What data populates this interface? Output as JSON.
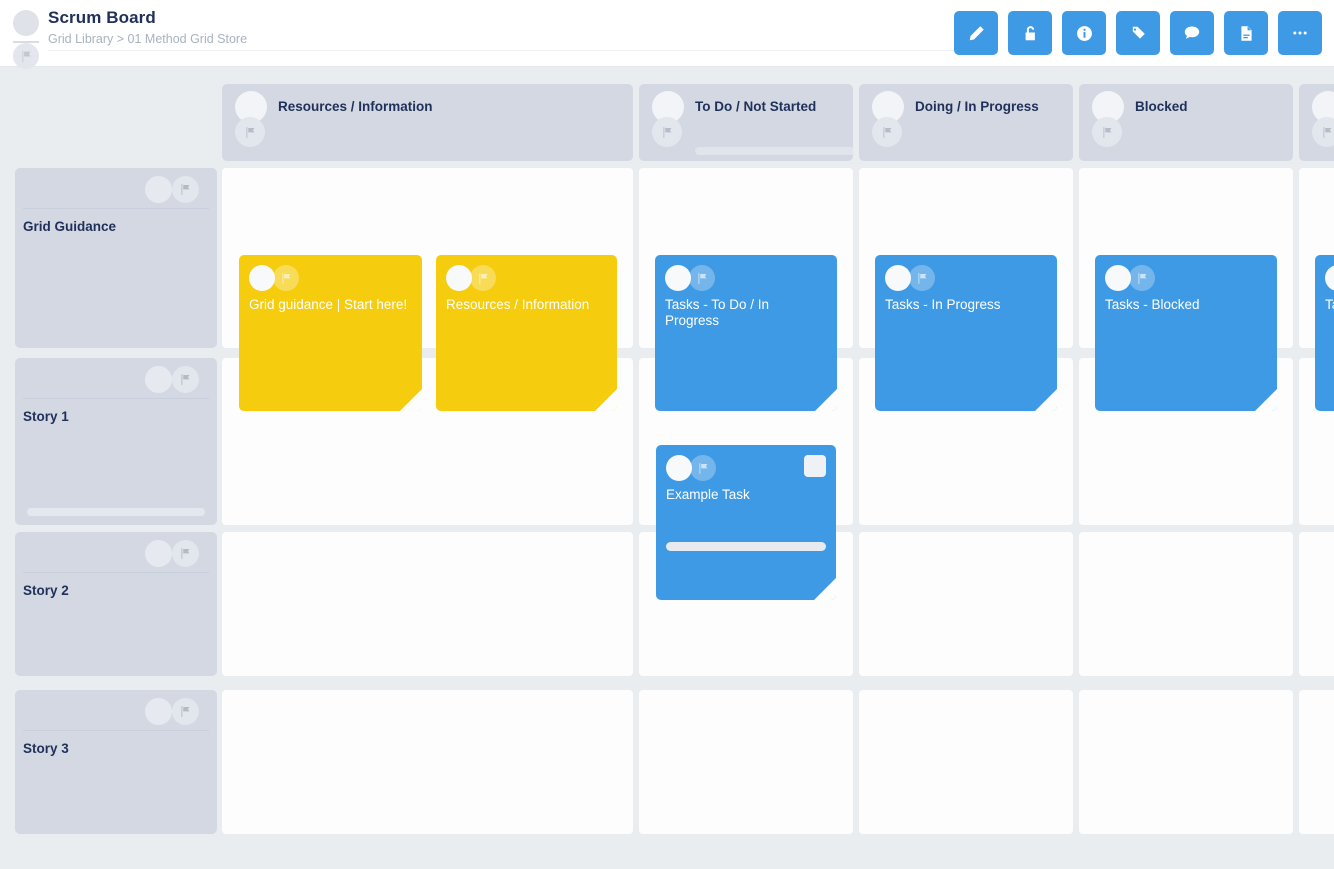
{
  "header": {
    "title": "Scrum Board",
    "breadcrumb": "Grid Library > 01 Method Grid Store",
    "toolbar": [
      {
        "name": "edit-button",
        "icon": "pencil-icon"
      },
      {
        "name": "unlock-button",
        "icon": "unlock-icon"
      },
      {
        "name": "info-button",
        "icon": "info-icon"
      },
      {
        "name": "tag-button",
        "icon": "tag-icon"
      },
      {
        "name": "comment-button",
        "icon": "comment-icon"
      },
      {
        "name": "export-pdf-button",
        "icon": "document-icon"
      },
      {
        "name": "more-options-button",
        "icon": "ellipsis-icon"
      }
    ]
  },
  "board": {
    "columns": [
      {
        "label": "Resources / Information",
        "has_bar": false
      },
      {
        "label": "To Do / Not Started",
        "has_bar": true
      },
      {
        "label": "Doing / In Progress",
        "has_bar": false
      },
      {
        "label": "Blocked",
        "has_bar": false
      },
      {
        "label": "",
        "has_bar": false
      }
    ],
    "rows": [
      {
        "label": "Grid Guidance",
        "has_bar": false
      },
      {
        "label": "Story 1",
        "has_bar": true
      },
      {
        "label": "Story 2",
        "has_bar": false
      },
      {
        "label": "Story 3",
        "has_bar": false
      }
    ],
    "cards": [
      {
        "title": "Grid guidance | Start here!",
        "color": "yellow",
        "badge": false,
        "bar": false
      },
      {
        "title": "Resources / Information",
        "color": "yellow",
        "badge": false,
        "bar": false
      },
      {
        "title": "Tasks - To Do / In Progress",
        "color": "blue",
        "badge": false,
        "bar": false
      },
      {
        "title": "Tasks - In Progress",
        "color": "blue",
        "badge": false,
        "bar": false
      },
      {
        "title": "Tasks - Blocked",
        "color": "blue",
        "badge": false,
        "bar": false
      },
      {
        "title": "Ta",
        "color": "blue",
        "badge": false,
        "bar": false
      },
      {
        "title": "Example Task",
        "color": "blue",
        "badge": true,
        "bar": true
      }
    ]
  },
  "colors": {
    "accent_blue": "#3f9ae5",
    "card_yellow": "#f5cc0e",
    "header_grey": "#d3d8e2",
    "page_background": "#e9edf0",
    "text_dark": "#1f3059"
  }
}
